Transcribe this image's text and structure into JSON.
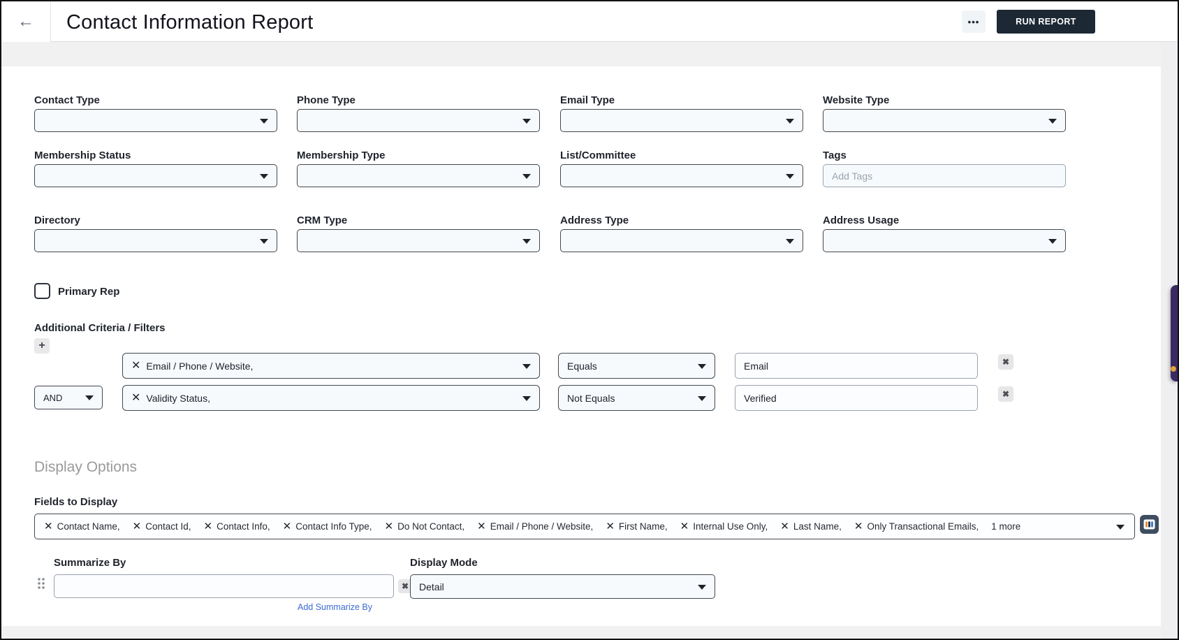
{
  "header": {
    "title": "Contact Information Report",
    "run_report_label": "RUN REPORT"
  },
  "icons": {
    "back": "←",
    "ellipsis": "•••",
    "plus": "+",
    "remove_chip": "✕",
    "remove_row": "✖"
  },
  "colors": {
    "run_report_bg": "#1c2834",
    "link_blue": "#3c6ad1",
    "side_tab_purple": "#3a2a63"
  },
  "fields": [
    {
      "label": "Contact Type",
      "value": ""
    },
    {
      "label": "Phone Type",
      "value": ""
    },
    {
      "label": "Email Type",
      "value": ""
    },
    {
      "label": "Website Type",
      "value": ""
    },
    {
      "label": "Membership Status",
      "value": ""
    },
    {
      "label": "Membership Type",
      "value": ""
    },
    {
      "label": "List/Committee",
      "value": ""
    },
    {
      "label": "Tags",
      "placeholder": "Add Tags"
    },
    {
      "label": "Directory",
      "value": ""
    },
    {
      "label": "CRM Type",
      "value": ""
    },
    {
      "label": "Address Type",
      "value": ""
    },
    {
      "label": "Address Usage",
      "value": ""
    }
  ],
  "primary_rep": {
    "label": "Primary Rep",
    "checked": false
  },
  "additional_criteria": {
    "title": "Additional Criteria / Filters",
    "rows": [
      {
        "conjunction": "",
        "field": "Email / Phone / Website,",
        "operator": "Equals",
        "value": "Email"
      },
      {
        "conjunction": "AND",
        "field": "Validity Status,",
        "operator": "Not Equals",
        "value": "Verified"
      }
    ]
  },
  "display_options": {
    "title": "Display Options",
    "fields_to_display": {
      "label": "Fields to Display",
      "chips": [
        "Contact Name,",
        "Contact Id,",
        "Contact Info,",
        "Contact Info Type,",
        "Do Not Contact,",
        "Email / Phone / Website,",
        "First Name,",
        "Internal Use Only,",
        "Last Name,",
        "Only Transactional Emails,"
      ],
      "more": "1 more"
    },
    "summarize_by": {
      "label": "Summarize By",
      "value": "",
      "add_link": "Add Summarize By"
    },
    "display_mode": {
      "label": "Display Mode",
      "value": "Detail"
    }
  }
}
